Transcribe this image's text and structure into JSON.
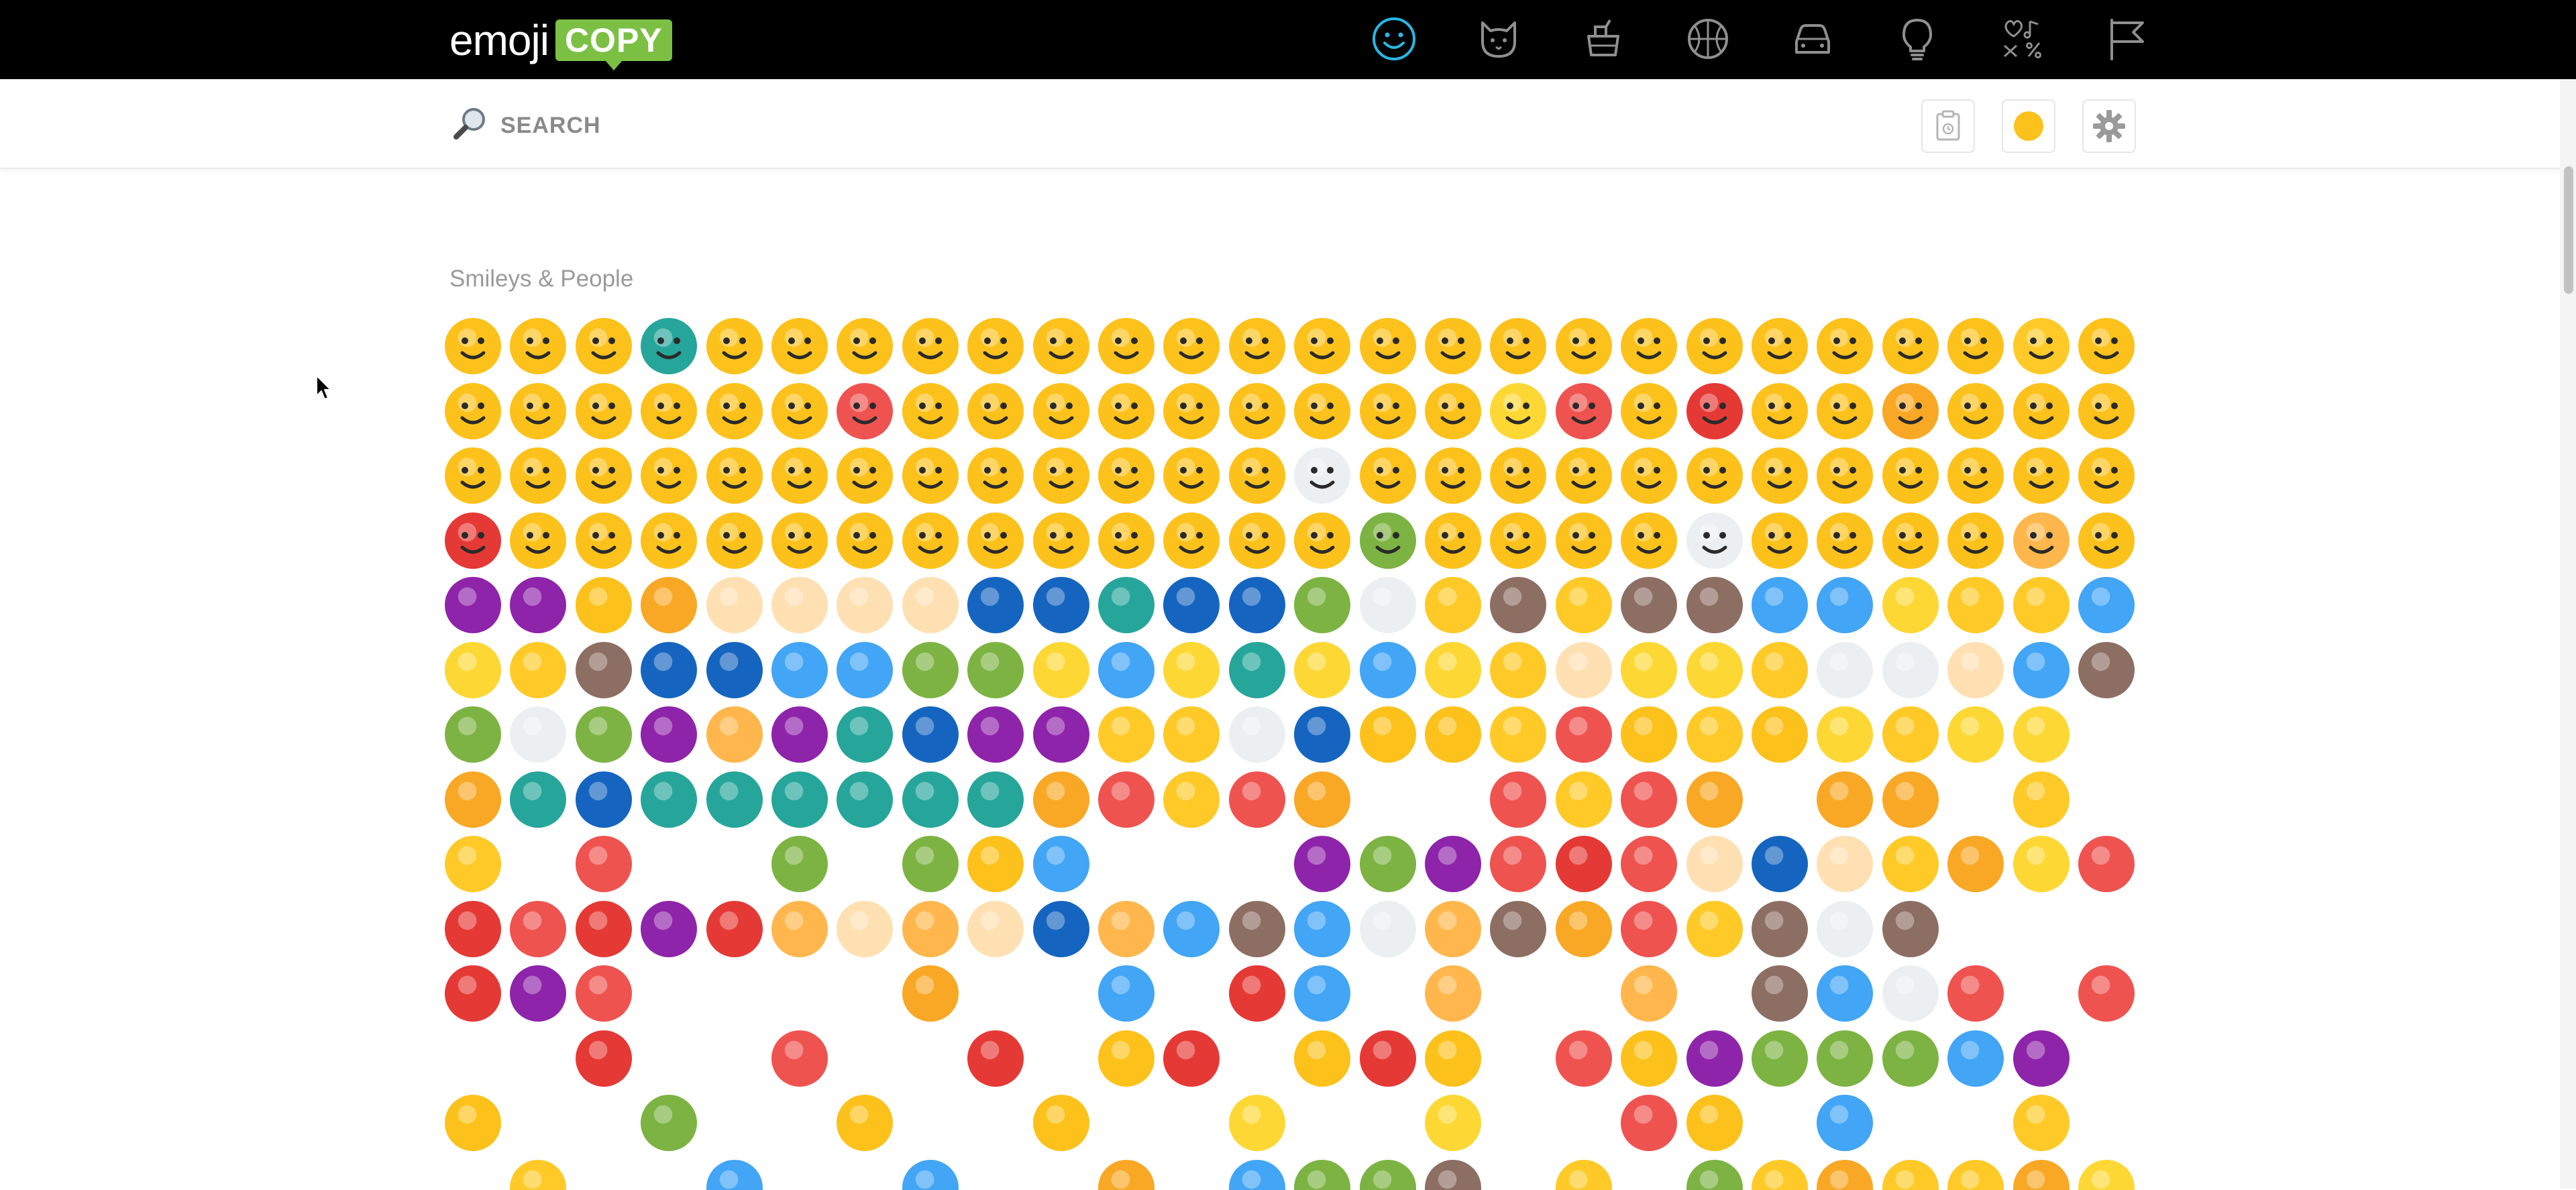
{
  "app": {
    "logo_word": "emoji",
    "logo_box": "COPY"
  },
  "categories": [
    {
      "id": "smileys",
      "icon": "smiley-icon",
      "active": true
    },
    {
      "id": "animals",
      "icon": "cat-icon",
      "active": false
    },
    {
      "id": "food",
      "icon": "food-icon",
      "active": false
    },
    {
      "id": "activities",
      "icon": "ball-icon",
      "active": false
    },
    {
      "id": "travel",
      "icon": "car-icon",
      "active": false
    },
    {
      "id": "objects",
      "icon": "lightbulb-icon",
      "active": false
    },
    {
      "id": "symbols",
      "icon": "symbols-icon",
      "active": false
    },
    {
      "id": "flags",
      "icon": "flag-icon",
      "active": false
    }
  ],
  "search": {
    "placeholder": "SEARCH",
    "value": ""
  },
  "toolbar": {
    "clipboard_icon": "clipboard-icon",
    "skin_tone_icon": "skin-tone-icon",
    "settings_icon": "gear-icon",
    "skin_tone_color": "#fcc21b"
  },
  "section": {
    "title": "Smileys & People"
  },
  "colors": {
    "accent": "#27b8e6",
    "logo_green": "#7bc043",
    "icon_gray": "#8f8f8f",
    "emoji_yellow": "#fcc21b"
  },
  "emoji_rows": [
    [
      "😀",
      "😃",
      "😄",
      "😁",
      "😆",
      "😅",
      "😂",
      "🤣",
      "☺️",
      "😊",
      "😇",
      "🙂",
      "🙃",
      "😉",
      "😌",
      "🤤",
      "😍",
      "🥰",
      "😘",
      "😗",
      "😙",
      "😚",
      "😋",
      "😛",
      "😝",
      "😜"
    ],
    [
      "🤪",
      "🤨",
      "🧐",
      "🤓",
      "😎",
      "🤩",
      "🥳",
      "😏",
      "😒",
      "😞",
      "😔",
      "😟",
      "😕",
      "🙁",
      "☹️",
      "😣",
      "😖",
      "😫",
      "😩",
      "🥺",
      "😢",
      "😭",
      "😤",
      "😠",
      "😡",
      "🤬"
    ],
    [
      "🤬",
      "🤯",
      "😳",
      "😶‍🌫️",
      "🥵",
      "🥶",
      "😱",
      "😨",
      "😰",
      "😥",
      "😓",
      "🤗",
      "🤔",
      "🤭",
      "🤫",
      "🤥",
      "🫤",
      "😶",
      "😐",
      "😑",
      "😬",
      "🙄",
      "😯",
      "😦",
      "😧",
      "😮"
    ],
    [
      "😲",
      "🥱",
      "😴",
      "😪",
      "😵",
      "😵‍💫",
      "🤐",
      "🥴",
      "🤢",
      "🤮",
      "🤧",
      "😷",
      "🤒",
      "🤕",
      "🤑",
      "🤠",
      "🥸",
      "😈",
      "👿",
      "👹",
      "👺",
      "🤡",
      "💩",
      "👻",
      "💀",
      "☠️"
    ],
    [
      "👽",
      "👾",
      "🤖",
      "🎃",
      "😺",
      "😸",
      "😹",
      "😻",
      "😼",
      "😽",
      "🙀",
      "😿",
      "😾",
      "🤲",
      "👐",
      "🙌",
      "👏",
      "🤝",
      "👍",
      "👎",
      "👊",
      "✊",
      "🤛",
      "🤜",
      "🤞",
      "✌️"
    ],
    [
      "🤘",
      "🤟",
      "👌",
      "🤌",
      "🤏",
      "👈",
      "👉",
      "👆",
      "👇",
      "☝️",
      "✋",
      "🤚",
      "🖐️",
      "🖖",
      "👋",
      "🤙",
      "💪",
      "🦾",
      "🖕",
      "✍️",
      "🙏",
      "🦶",
      "🦵",
      "🦿",
      "💄",
      "💋"
    ],
    [
      "👄",
      "🦷",
      "👅",
      "👂",
      "🦻",
      "👃",
      "👣",
      "👁️",
      "👀",
      "🧠",
      "🫀",
      "🫁",
      "🦴",
      "🗣️",
      "👤",
      "👥",
      "🫂",
      "👶",
      "👧",
      "🧒",
      "👦",
      "👩",
      "🧑",
      "👨",
      "👩",
      "👱‍♀️"
    ],
    [
      "👱",
      "👩‍🦰",
      "👨‍🦰",
      "👩‍🦱",
      "👨‍🦱",
      "👩‍🦲",
      "👨‍🦲",
      "👩‍🦳",
      "👨‍🦳",
      "🧔",
      "👵",
      "🧓",
      "👴",
      "🧔",
      "🧔‍♂️",
      "🧔‍♀️",
      "👵",
      "🧓",
      "👴",
      "👲",
      "👳‍♀️",
      "👳",
      "🧕",
      "👮‍♀️",
      "👮",
      "👮‍♂️"
    ],
    [
      "👮",
      "👷‍♀️",
      "👷",
      "👷‍♂️",
      "💂‍♀️",
      "💂",
      "💂‍♂️",
      "🕵️‍♀️",
      "🕵️",
      "🕵️‍♂️",
      "👩‍⚕️",
      "🧑‍⚕️",
      "👨‍⚕️",
      "👩‍🌾",
      "🧑‍🌾",
      "👨‍🌾",
      "👩‍🍳",
      "🧑‍🍳",
      "👨‍🍳",
      "👩‍🎓",
      "🧑‍🎓",
      "👨‍🎓",
      "👩‍🎤",
      "🧑‍🎤",
      "👨‍🎤",
      "👩‍🏫"
    ],
    [
      "🧑‍🏫",
      "👨‍🏫",
      "👩‍🏭",
      "🧑‍🏭",
      "👨‍🏭",
      "👩‍💻",
      "🧑‍💻",
      "👨‍💻",
      "👩‍💼",
      "🧑‍💼",
      "👨‍💼",
      "👩‍🔧",
      "🧑‍🔧",
      "👨‍🔧",
      "👩‍🔬",
      "🧑‍🔬",
      "👨‍🔬",
      "👩‍🎨",
      "🧑‍🎨",
      "👨‍🎨",
      "👩‍🚒",
      "🧑‍🚒",
      "👨‍🚒",
      "👩‍✈️",
      "🧑‍✈️",
      "👨‍✈️"
    ],
    [
      "👩‍🚀",
      "🧑‍🚀",
      "👨‍🚀",
      "👩‍⚖️",
      "🧑‍⚖️",
      "👨‍⚖️",
      "👰‍♀️",
      "👰",
      "👰‍♂️",
      "🤵‍♀️",
      "🤵",
      "🤵‍♂️",
      "👸",
      "🤴",
      "🦸‍♀️",
      "🦸",
      "🦸‍♂️",
      "🦹‍♀️",
      "🦹",
      "🦹‍♂️",
      "🥷",
      "🤶",
      "🧑‍🎄",
      "🎅",
      "🧙‍♀️",
      "🧙"
    ],
    [
      "🧙‍♂️",
      "🧝‍♀️",
      "🧝",
      "🧝‍♂️",
      "🧛‍♀️",
      "🧛",
      "🧛‍♂️",
      "🧟‍♀️",
      "🧟",
      "🧟‍♂️",
      "🧞‍♀️",
      "🧞",
      "🧞‍♂️",
      "🧜‍♀️",
      "🧜",
      "🧜‍♂️",
      "🧚‍♀️",
      "🧚",
      "🧚‍♂️",
      "👼",
      "🤰",
      "🤱",
      "👩‍🍼",
      "🧑‍🍼",
      "👨‍🍼",
      "🙇‍♀️"
    ],
    [
      "🙇",
      "🙇‍♂️",
      "💁‍♀️",
      "💁",
      "💁‍♂️",
      "🙅‍♀️",
      "🙅",
      "🙅‍♂️",
      "🙆‍♀️",
      "🙆",
      "🙆‍♂️",
      "🙋‍♀️",
      "🙋",
      "🙋‍♂️",
      "🧏‍♀️",
      "🧏",
      "🧏‍♂️",
      "🤦‍♀️",
      "🤦",
      "🤦‍♂️",
      "🤷‍♀️",
      "🤷",
      "🤷‍♂️",
      "🙎‍♀️",
      "🙎",
      "🙎‍♂️"
    ],
    [
      "🙍‍♀️",
      "🙍",
      "🙍‍♂️",
      "💇‍♀️",
      "💇",
      "💇‍♂️",
      "💆‍♀️",
      "💆",
      "💆‍♂️",
      "🧖‍♀️",
      "🧖",
      "🧖‍♂️",
      "💅",
      "🤳",
      "💃",
      "🕺",
      "👯‍♀️",
      "👯",
      "👯‍♂️",
      "🕴️",
      "👩‍🦽",
      "🧑‍🦽",
      "👨‍🦽",
      "👩‍🦼",
      "🧑‍🦼",
      "👨‍🦼"
    ]
  ]
}
